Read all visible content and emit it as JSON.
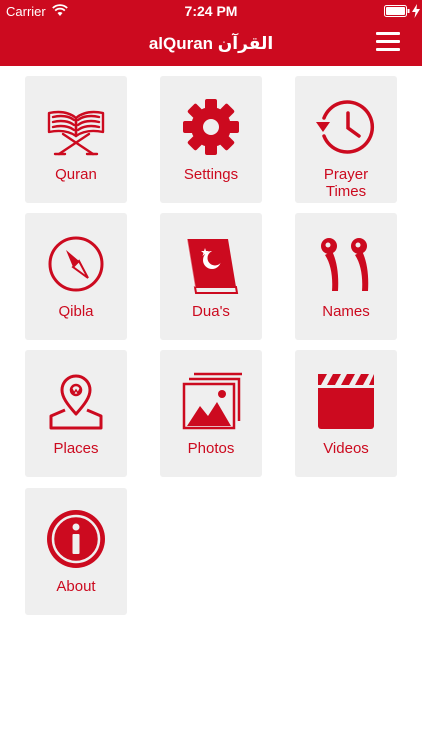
{
  "status_bar": {
    "carrier": "Carrier",
    "time": "7:24 PM"
  },
  "header": {
    "title": "alQuran القرآن"
  },
  "colors": {
    "accent": "#cc0a1f",
    "tile_bg": "#efefef"
  },
  "tiles": [
    {
      "label": "Quran",
      "icon": "quran-stand-icon"
    },
    {
      "label": "Settings",
      "icon": "gear-icon"
    },
    {
      "label": "Prayer Times",
      "icon": "clock-history-icon"
    },
    {
      "label": "Qibla",
      "icon": "compass-icon"
    },
    {
      "label": "Dua's",
      "icon": "book-crescent-icon"
    },
    {
      "label": "Names",
      "icon": "arabic-99-icon"
    },
    {
      "label": "Places",
      "icon": "map-pin-icon"
    },
    {
      "label": "Photos",
      "icon": "photos-icon"
    },
    {
      "label": "Videos",
      "icon": "clapperboard-icon"
    },
    {
      "label": "About",
      "icon": "info-icon"
    }
  ]
}
